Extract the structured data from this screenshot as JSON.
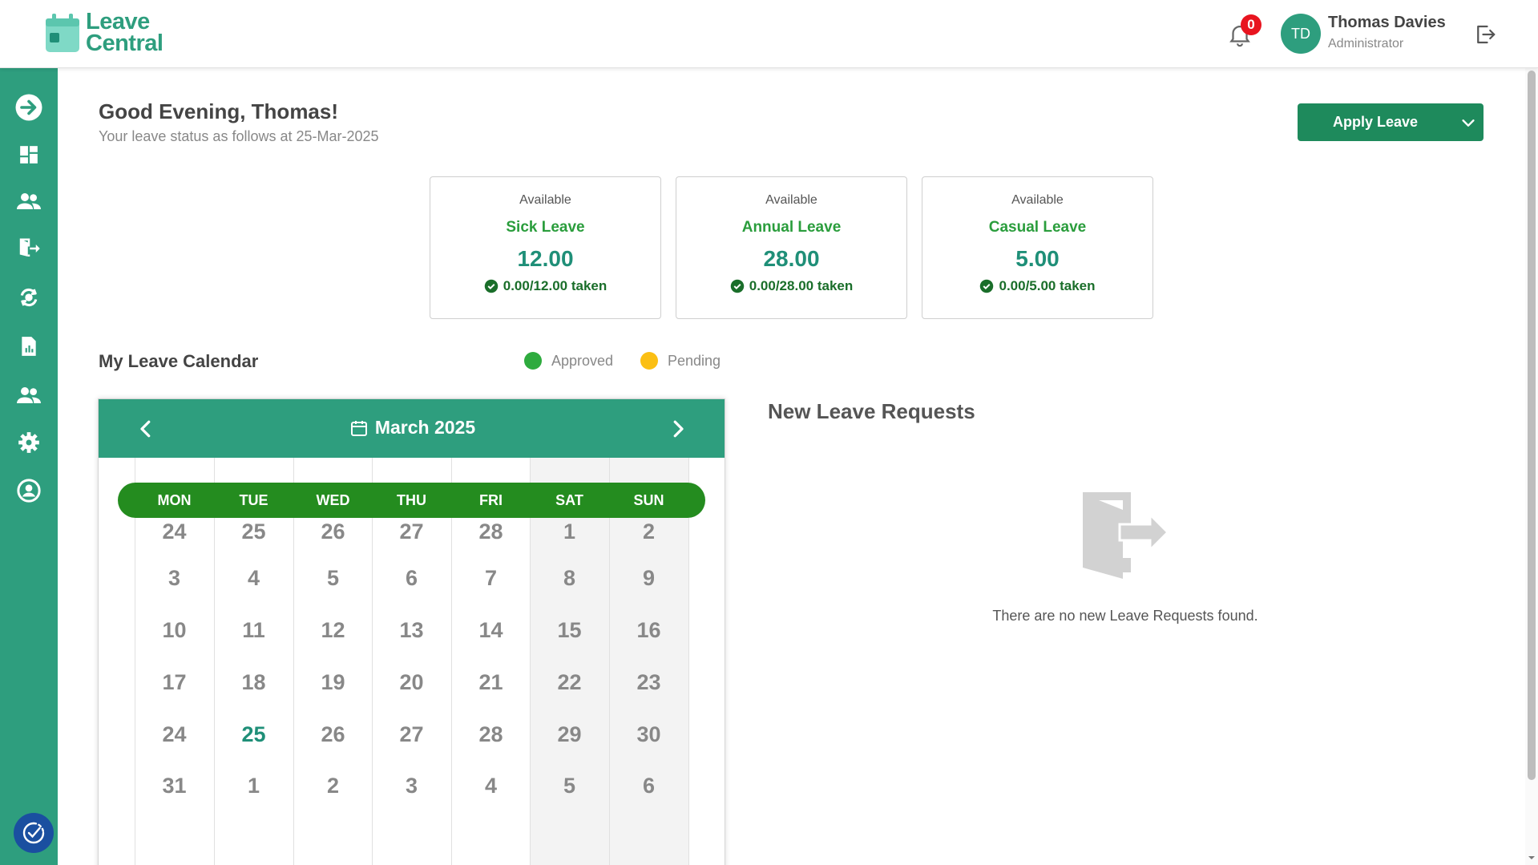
{
  "header": {
    "logo_line1": "Leave",
    "logo_line2": "Central",
    "notification_count": "0",
    "user_initials": "TD",
    "user_name": "Thomas Davies",
    "user_role": "Administrator"
  },
  "sidebar": {
    "items": [
      {
        "icon": "arrow-right-circle-icon"
      },
      {
        "icon": "dashboard-icon"
      },
      {
        "icon": "users-icon"
      },
      {
        "icon": "exit-door-icon"
      },
      {
        "icon": "recycle-icon"
      },
      {
        "icon": "report-icon"
      },
      {
        "icon": "team-icon"
      },
      {
        "icon": "gear-icon"
      },
      {
        "icon": "account-circle-icon"
      }
    ],
    "bottom_icon": "accessibility-icon"
  },
  "greeting": {
    "title": "Good Evening, Thomas!",
    "subtitle": "Your leave status as follows at 25-Mar-2025"
  },
  "apply_button": {
    "label": "Apply Leave"
  },
  "cards": [
    {
      "available": "Available",
      "type": "Sick Leave",
      "value": "12.00",
      "taken": "0.00/12.00 taken"
    },
    {
      "available": "Available",
      "type": "Annual Leave",
      "value": "28.00",
      "taken": "0.00/28.00 taken"
    },
    {
      "available": "Available",
      "type": "Casual Leave",
      "value": "5.00",
      "taken": "0.00/5.00 taken"
    }
  ],
  "calendar": {
    "title": "My Leave Calendar",
    "legend": {
      "approved": "Approved",
      "pending": "Pending"
    },
    "month": "March 2025",
    "weekdays": [
      "MON",
      "TUE",
      "WED",
      "THU",
      "FRI",
      "SAT",
      "SUN"
    ],
    "weeks": [
      [
        "24",
        "25",
        "26",
        "27",
        "28",
        "1",
        "2"
      ],
      [
        "3",
        "4",
        "5",
        "6",
        "7",
        "8",
        "9"
      ],
      [
        "10",
        "11",
        "12",
        "13",
        "14",
        "15",
        "16"
      ],
      [
        "17",
        "18",
        "19",
        "20",
        "21",
        "22",
        "23"
      ],
      [
        "24",
        "25",
        "26",
        "27",
        "28",
        "29",
        "30"
      ],
      [
        "31",
        "1",
        "2",
        "3",
        "4",
        "5",
        "6"
      ]
    ],
    "today": "25"
  },
  "new_requests": {
    "title": "New Leave Requests",
    "empty_text": "There are no new Leave Requests found."
  },
  "colors": {
    "primary": "#2e9e7e",
    "button": "#1e8a5c",
    "weekday_bar": "#248c1f",
    "approved": "#2eab3e",
    "pending": "#fbbf14",
    "badge": "#e8141f"
  }
}
